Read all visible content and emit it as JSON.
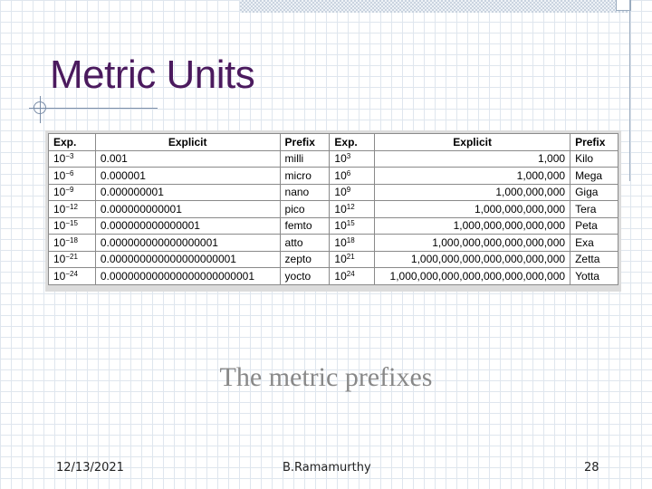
{
  "slide": {
    "title": "Metric Units",
    "caption": "The metric prefixes",
    "footer": {
      "date": "12/13/2021",
      "author": "B.Ramamurthy",
      "page": "28"
    }
  },
  "table": {
    "headers": [
      "Exp.",
      "Explicit",
      "Prefix",
      "Exp.",
      "Explicit",
      "Prefix"
    ],
    "rows": [
      {
        "small_base": "10",
        "small_exp": "−3",
        "small_explicit": "0.001",
        "small_prefix": "milli",
        "large_base": "10",
        "large_exp": "3",
        "large_explicit": "1,000",
        "large_prefix": "Kilo"
      },
      {
        "small_base": "10",
        "small_exp": "−6",
        "small_explicit": "0.000001",
        "small_prefix": "micro",
        "large_base": "10",
        "large_exp": "6",
        "large_explicit": "1,000,000",
        "large_prefix": "Mega"
      },
      {
        "small_base": "10",
        "small_exp": "−9",
        "small_explicit": "0.000000001",
        "small_prefix": "nano",
        "large_base": "10",
        "large_exp": "9",
        "large_explicit": "1,000,000,000",
        "large_prefix": "Giga"
      },
      {
        "small_base": "10",
        "small_exp": "−12",
        "small_explicit": "0.000000000001",
        "small_prefix": "pico",
        "large_base": "10",
        "large_exp": "12",
        "large_explicit": "1,000,000,000,000",
        "large_prefix": "Tera"
      },
      {
        "small_base": "10",
        "small_exp": "−15",
        "small_explicit": "0.000000000000001",
        "small_prefix": "femto",
        "large_base": "10",
        "large_exp": "15",
        "large_explicit": "1,000,000,000,000,000",
        "large_prefix": "Peta"
      },
      {
        "small_base": "10",
        "small_exp": "−18",
        "small_explicit": "0.000000000000000001",
        "small_prefix": "atto",
        "large_base": "10",
        "large_exp": "18",
        "large_explicit": "1,000,000,000,000,000,000",
        "large_prefix": "Exa"
      },
      {
        "small_base": "10",
        "small_exp": "−21",
        "small_explicit": "0.000000000000000000001",
        "small_prefix": "zepto",
        "large_base": "10",
        "large_exp": "21",
        "large_explicit": "1,000,000,000,000,000,000,000",
        "large_prefix": "Zetta"
      },
      {
        "small_base": "10",
        "small_exp": "−24",
        "small_explicit": "0.000000000000000000000001",
        "small_prefix": "yocto",
        "large_base": "10",
        "large_exp": "24",
        "large_explicit": "1,000,000,000,000,000,000,000,000",
        "large_prefix": "Yotta"
      }
    ]
  }
}
